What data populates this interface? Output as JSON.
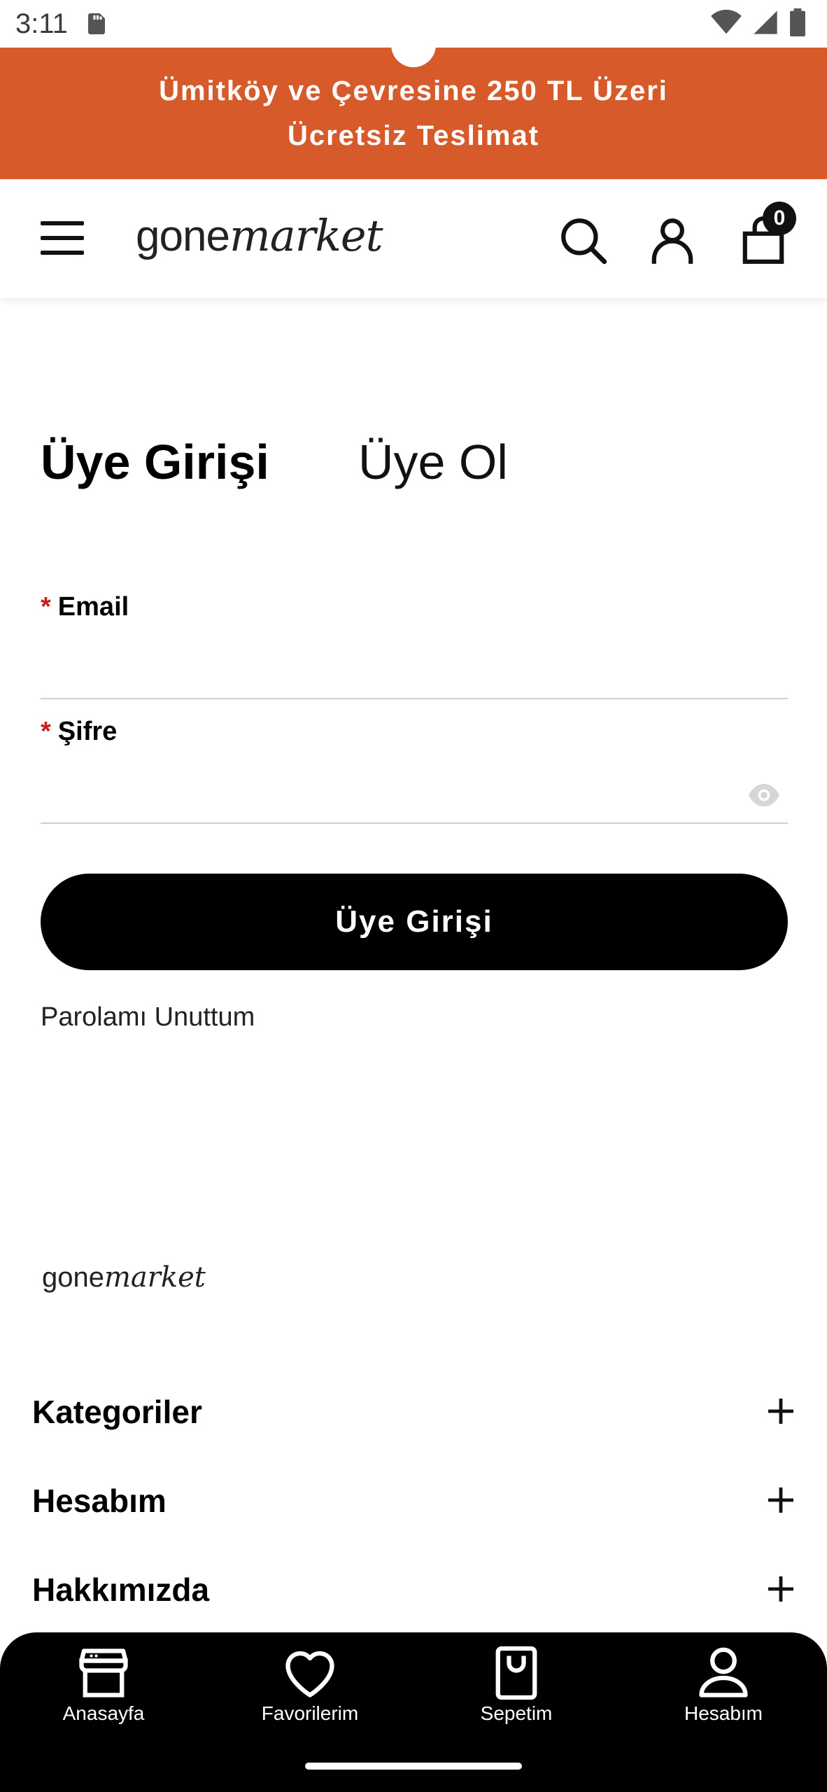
{
  "status_bar": {
    "time": "3:11"
  },
  "promo": {
    "line1": "Ümitköy ve Çevresine 250 TL Üzeri",
    "line2": "Ücretsiz Teslimat",
    "bg_color": "#d75a2b"
  },
  "header": {
    "logo_plain": "gone",
    "logo_italic": "market",
    "cart_count": "0"
  },
  "tabs": {
    "login": "Üye Girişi",
    "register": "Üye Ol"
  },
  "form": {
    "required_mark": "*",
    "email_label": "Email",
    "email_value": "",
    "password_label": "Şifre",
    "password_value": "",
    "submit_label": "Üye Girişi",
    "forgot_label": "Parolamı Unuttum"
  },
  "footer": {
    "logo_plain": "gone",
    "logo_italic": "market",
    "sections": [
      {
        "label": "Kategoriler"
      },
      {
        "label": "Hesabım"
      },
      {
        "label": "Hakkımızda"
      }
    ]
  },
  "bottom_nav": [
    {
      "label": "Anasayfa",
      "icon": "store-icon"
    },
    {
      "label": "Favorilerim",
      "icon": "heart-icon"
    },
    {
      "label": "Sepetim",
      "icon": "bag-icon"
    },
    {
      "label": "Hesabım",
      "icon": "user-icon"
    }
  ]
}
